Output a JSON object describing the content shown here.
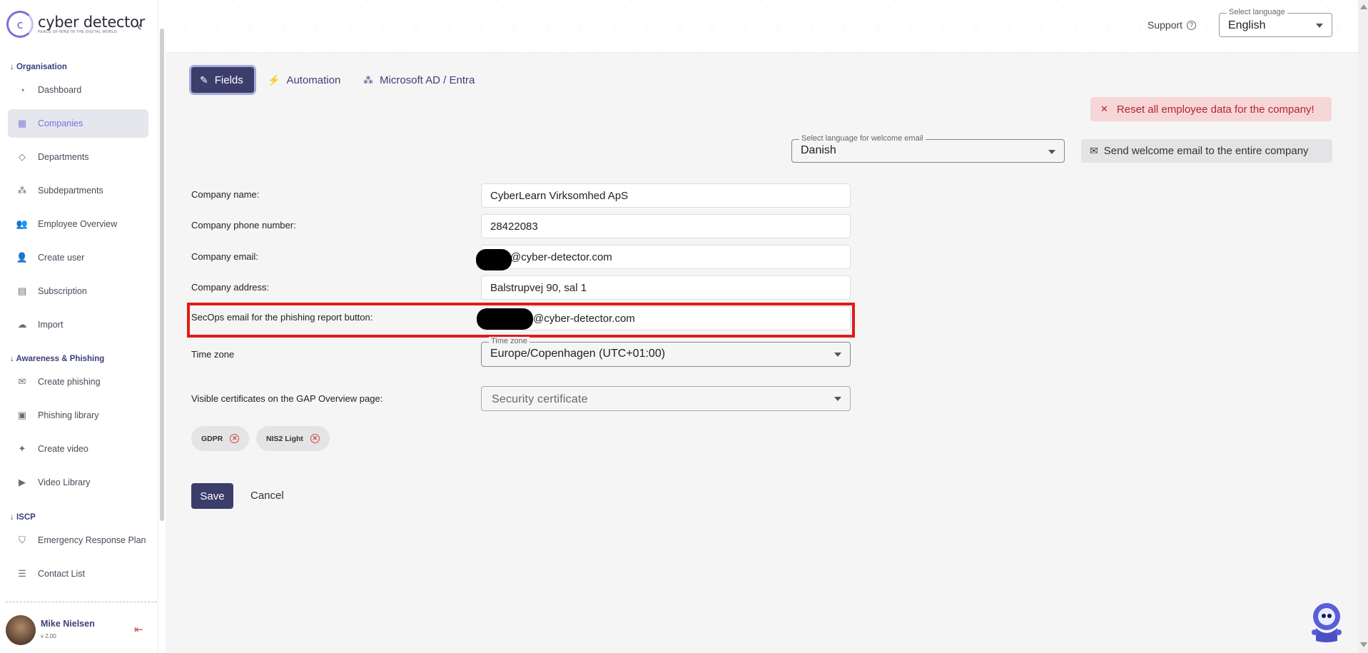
{
  "brand": {
    "name": "cyber detector",
    "tagline": "PEACE OF MIND IN THE DIGITAL WORLD",
    "logo_letter": "c",
    "accent": "#3b3d6b"
  },
  "sidebar": {
    "sections": [
      {
        "label": "Organisation"
      },
      {
        "label": "Awareness & Phishing"
      },
      {
        "label": "ISCP"
      }
    ],
    "items": [
      {
        "label": "Dashboard",
        "icon": "gauge-icon"
      },
      {
        "label": "Companies",
        "icon": "building-icon",
        "active": true
      },
      {
        "label": "Departments",
        "icon": "layers-icon"
      },
      {
        "label": "Subdepartments",
        "icon": "hierarchy-icon"
      },
      {
        "label": "Employee Overview",
        "icon": "users-icon"
      },
      {
        "label": "Create user",
        "icon": "user-add-icon"
      },
      {
        "label": "Subscription",
        "icon": "id-card-icon"
      },
      {
        "label": "Import",
        "icon": "cloud-upload-icon"
      },
      {
        "label": "Create phishing",
        "icon": "mail-hook-icon"
      },
      {
        "label": "Phishing library",
        "icon": "archive-icon"
      },
      {
        "label": "Create video",
        "icon": "magic-wand-icon"
      },
      {
        "label": "Video Library",
        "icon": "video-icon"
      },
      {
        "label": "Emergency Response Plan",
        "icon": "shield-icon"
      },
      {
        "label": "Contact List",
        "icon": "contacts-icon"
      }
    ],
    "user": {
      "name": "Mike Nielsen",
      "version": "v 2.00"
    }
  },
  "header": {
    "support_label": "Support",
    "language_label": "Select language",
    "language_value": "English"
  },
  "tabs": [
    {
      "label": "Fields",
      "icon": "edit-icon",
      "active": true
    },
    {
      "label": "Automation",
      "icon": "bolt-icon"
    },
    {
      "label": "Microsoft AD / Entra",
      "icon": "sitemap-icon"
    }
  ],
  "actions": {
    "reset_label": "Reset all employee data for the company!",
    "welcome_lang_label": "Select language for welcome email",
    "welcome_lang_value": "Danish",
    "welcome_btn_label": "Send welcome email to the entire company"
  },
  "form": {
    "company_name_label": "Company name:",
    "company_name": "CyberLearn Virksomhed ApS",
    "phone_label": "Company phone number:",
    "phone": "28422083",
    "email_label": "Company email:",
    "email": "@cyber-detector.com",
    "address_label": "Company address:",
    "address": "Balstrupvej 90, sal 1",
    "secops_label": "SecOps email for the phishing report button:",
    "secops": "@cyber-detector.com",
    "timezone_label": "Time zone",
    "timezone_float": "Time zone",
    "timezone": "Europe/Copenhagen (UTC+01:00)",
    "certs_label": "Visible certificates on the GAP Overview page:",
    "certs_placeholder": "Security certificate",
    "chips": [
      "GDPR",
      "NIS2 Light"
    ],
    "save_label": "Save",
    "cancel_label": "Cancel"
  }
}
